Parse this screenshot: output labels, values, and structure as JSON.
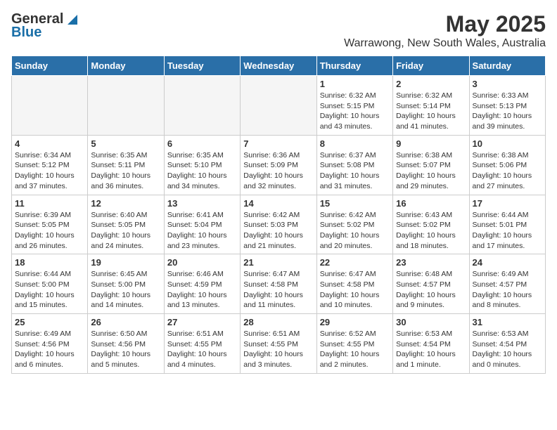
{
  "header": {
    "logo_line1": "General",
    "logo_line2": "Blue",
    "title": "May 2025",
    "subtitle": "Warrawong, New South Wales, Australia"
  },
  "weekdays": [
    "Sunday",
    "Monday",
    "Tuesday",
    "Wednesday",
    "Thursday",
    "Friday",
    "Saturday"
  ],
  "weeks": [
    [
      {
        "day": "",
        "info": ""
      },
      {
        "day": "",
        "info": ""
      },
      {
        "day": "",
        "info": ""
      },
      {
        "day": "",
        "info": ""
      },
      {
        "day": "1",
        "info": "Sunrise: 6:32 AM\nSunset: 5:15 PM\nDaylight: 10 hours\nand 43 minutes."
      },
      {
        "day": "2",
        "info": "Sunrise: 6:32 AM\nSunset: 5:14 PM\nDaylight: 10 hours\nand 41 minutes."
      },
      {
        "day": "3",
        "info": "Sunrise: 6:33 AM\nSunset: 5:13 PM\nDaylight: 10 hours\nand 39 minutes."
      }
    ],
    [
      {
        "day": "4",
        "info": "Sunrise: 6:34 AM\nSunset: 5:12 PM\nDaylight: 10 hours\nand 37 minutes."
      },
      {
        "day": "5",
        "info": "Sunrise: 6:35 AM\nSunset: 5:11 PM\nDaylight: 10 hours\nand 36 minutes."
      },
      {
        "day": "6",
        "info": "Sunrise: 6:35 AM\nSunset: 5:10 PM\nDaylight: 10 hours\nand 34 minutes."
      },
      {
        "day": "7",
        "info": "Sunrise: 6:36 AM\nSunset: 5:09 PM\nDaylight: 10 hours\nand 32 minutes."
      },
      {
        "day": "8",
        "info": "Sunrise: 6:37 AM\nSunset: 5:08 PM\nDaylight: 10 hours\nand 31 minutes."
      },
      {
        "day": "9",
        "info": "Sunrise: 6:38 AM\nSunset: 5:07 PM\nDaylight: 10 hours\nand 29 minutes."
      },
      {
        "day": "10",
        "info": "Sunrise: 6:38 AM\nSunset: 5:06 PM\nDaylight: 10 hours\nand 27 minutes."
      }
    ],
    [
      {
        "day": "11",
        "info": "Sunrise: 6:39 AM\nSunset: 5:05 PM\nDaylight: 10 hours\nand 26 minutes."
      },
      {
        "day": "12",
        "info": "Sunrise: 6:40 AM\nSunset: 5:05 PM\nDaylight: 10 hours\nand 24 minutes."
      },
      {
        "day": "13",
        "info": "Sunrise: 6:41 AM\nSunset: 5:04 PM\nDaylight: 10 hours\nand 23 minutes."
      },
      {
        "day": "14",
        "info": "Sunrise: 6:42 AM\nSunset: 5:03 PM\nDaylight: 10 hours\nand 21 minutes."
      },
      {
        "day": "15",
        "info": "Sunrise: 6:42 AM\nSunset: 5:02 PM\nDaylight: 10 hours\nand 20 minutes."
      },
      {
        "day": "16",
        "info": "Sunrise: 6:43 AM\nSunset: 5:02 PM\nDaylight: 10 hours\nand 18 minutes."
      },
      {
        "day": "17",
        "info": "Sunrise: 6:44 AM\nSunset: 5:01 PM\nDaylight: 10 hours\nand 17 minutes."
      }
    ],
    [
      {
        "day": "18",
        "info": "Sunrise: 6:44 AM\nSunset: 5:00 PM\nDaylight: 10 hours\nand 15 minutes."
      },
      {
        "day": "19",
        "info": "Sunrise: 6:45 AM\nSunset: 5:00 PM\nDaylight: 10 hours\nand 14 minutes."
      },
      {
        "day": "20",
        "info": "Sunrise: 6:46 AM\nSunset: 4:59 PM\nDaylight: 10 hours\nand 13 minutes."
      },
      {
        "day": "21",
        "info": "Sunrise: 6:47 AM\nSunset: 4:58 PM\nDaylight: 10 hours\nand 11 minutes."
      },
      {
        "day": "22",
        "info": "Sunrise: 6:47 AM\nSunset: 4:58 PM\nDaylight: 10 hours\nand 10 minutes."
      },
      {
        "day": "23",
        "info": "Sunrise: 6:48 AM\nSunset: 4:57 PM\nDaylight: 10 hours\nand 9 minutes."
      },
      {
        "day": "24",
        "info": "Sunrise: 6:49 AM\nSunset: 4:57 PM\nDaylight: 10 hours\nand 8 minutes."
      }
    ],
    [
      {
        "day": "25",
        "info": "Sunrise: 6:49 AM\nSunset: 4:56 PM\nDaylight: 10 hours\nand 6 minutes."
      },
      {
        "day": "26",
        "info": "Sunrise: 6:50 AM\nSunset: 4:56 PM\nDaylight: 10 hours\nand 5 minutes."
      },
      {
        "day": "27",
        "info": "Sunrise: 6:51 AM\nSunset: 4:55 PM\nDaylight: 10 hours\nand 4 minutes."
      },
      {
        "day": "28",
        "info": "Sunrise: 6:51 AM\nSunset: 4:55 PM\nDaylight: 10 hours\nand 3 minutes."
      },
      {
        "day": "29",
        "info": "Sunrise: 6:52 AM\nSunset: 4:55 PM\nDaylight: 10 hours\nand 2 minutes."
      },
      {
        "day": "30",
        "info": "Sunrise: 6:53 AM\nSunset: 4:54 PM\nDaylight: 10 hours\nand 1 minute."
      },
      {
        "day": "31",
        "info": "Sunrise: 6:53 AM\nSunset: 4:54 PM\nDaylight: 10 hours\nand 0 minutes."
      }
    ]
  ]
}
